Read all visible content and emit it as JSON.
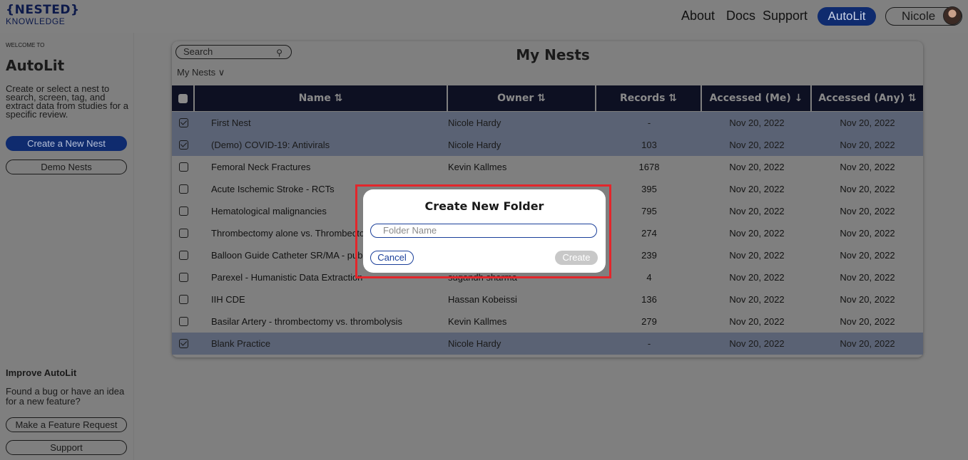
{
  "header": {
    "logo_line1": "{NESTED}",
    "logo_line2": "KNOWLEDGE",
    "nav": [
      "About",
      "Docs",
      "Support"
    ],
    "autolit_button": "AutoLit",
    "user_button": "Nicole"
  },
  "sidebar": {
    "welcome": "WELCOME TO",
    "title": "AutoLit",
    "description": "Create or select a nest to search, screen, tag, and extract data from studies for a specific review.",
    "create_button": "Create a New Nest",
    "demo_button": "Demo Nests",
    "improve_title": "Improve AutoLit",
    "improve_text": "Found a bug or have an idea for a new feature?",
    "feature_button": "Make a Feature Request",
    "support_button": "Support"
  },
  "main": {
    "search_placeholder": "Search",
    "search_icon": "search-icon",
    "filter_dropdown": "My Nests ∨",
    "title": "My Nests",
    "columns": [
      "Name ⇅",
      "Owner ⇅",
      "Records ⇅",
      "Accessed (Me) ↓",
      "Accessed (Any) ⇅"
    ],
    "rows": [
      {
        "checked": true,
        "name": "First Nest",
        "owner": "Nicole Hardy",
        "records": "-",
        "accessed_me": "Nov 20, 2022",
        "accessed_any": "Nov 20, 2022"
      },
      {
        "checked": true,
        "name": "(Demo) COVID-19: Antivirals",
        "owner": "Nicole Hardy",
        "records": "103",
        "accessed_me": "Nov 20, 2022",
        "accessed_any": "Nov 20, 2022"
      },
      {
        "checked": false,
        "name": "Femoral Neck Fractures",
        "owner": "Kevin Kallmes",
        "records": "1678",
        "accessed_me": "Nov 20, 2022",
        "accessed_any": "Nov 20, 2022"
      },
      {
        "checked": false,
        "name": "Acute Ischemic Stroke - RCTs",
        "owner": "",
        "records": "395",
        "accessed_me": "Nov 20, 2022",
        "accessed_any": "Nov 20, 2022"
      },
      {
        "checked": false,
        "name": "Hematological malignancies",
        "owner": "",
        "records": "795",
        "accessed_me": "Nov 20, 2022",
        "accessed_any": "Nov 20, 2022"
      },
      {
        "checked": false,
        "name": "Thrombectomy alone vs. Thrombector",
        "owner": "",
        "records": "274",
        "accessed_me": "Nov 20, 2022",
        "accessed_any": "Nov 20, 2022"
      },
      {
        "checked": false,
        "name": "Balloon Guide Catheter SR/MA - publi",
        "owner": "",
        "records": "239",
        "accessed_me": "Nov 20, 2022",
        "accessed_any": "Nov 20, 2022"
      },
      {
        "checked": false,
        "name": "Parexel - Humanistic Data Extraction",
        "owner": "sugandh sharma",
        "records": "4",
        "accessed_me": "Nov 20, 2022",
        "accessed_any": "Nov 20, 2022"
      },
      {
        "checked": false,
        "name": "IIH CDE",
        "owner": "Hassan Kobeissi",
        "records": "136",
        "accessed_me": "Nov 20, 2022",
        "accessed_any": "Nov 20, 2022"
      },
      {
        "checked": false,
        "name": "Basilar Artery - thrombectomy vs. thrombolysis",
        "owner": "Kevin Kallmes",
        "records": "279",
        "accessed_me": "Nov 20, 2022",
        "accessed_any": "Nov 20, 2022"
      },
      {
        "checked": true,
        "name": "Blank Practice",
        "owner": "Nicole Hardy",
        "records": "-",
        "accessed_me": "Nov 20, 2022",
        "accessed_any": "Nov 20, 2022"
      }
    ]
  },
  "modal": {
    "title": "Create New Folder",
    "input_placeholder": "Folder Name",
    "cancel": "Cancel",
    "create": "Create"
  }
}
